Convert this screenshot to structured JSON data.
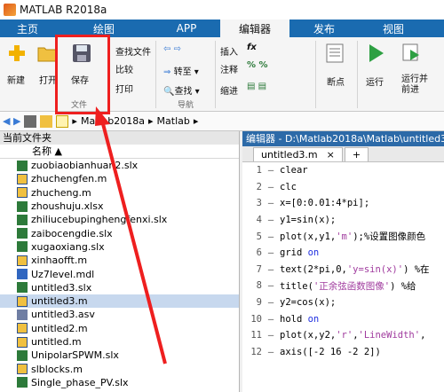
{
  "window": {
    "title": "MATLAB R2018a"
  },
  "tabs": [
    "主页",
    "绘图",
    "APP",
    "编辑器",
    "发布",
    "视图"
  ],
  "ribbon": {
    "new": "新建",
    "open": "打开",
    "save": "保存",
    "find_files": "查找文件",
    "compare": "比较",
    "print": "打印",
    "goto": "转至",
    "find": "查找",
    "nav_label": "导航",
    "insert": "插入",
    "comment": "注释",
    "indent": "缩进",
    "breakpoints": "断点",
    "run": "运行",
    "run_advance_1": "运行并",
    "run_advance_2": "前进",
    "file_label": "文件"
  },
  "address": {
    "path": [
      "Matlab2018a",
      "Matlab"
    ]
  },
  "file_panel": {
    "title": "当前文件夹",
    "column": "名称 ▲"
  },
  "files": [
    {
      "name": "zuobiaobianhuan2.slx",
      "type": "xlsx"
    },
    {
      "name": "zhuchengfen.m",
      "type": "m"
    },
    {
      "name": "zhucheng.m",
      "type": "m"
    },
    {
      "name": "zhoushuju.xlsx",
      "type": "xlsx"
    },
    {
      "name": "zhiliucebupinghengfenxi.slx",
      "type": "xlsx"
    },
    {
      "name": "zaibocengdie.slx",
      "type": "xlsx"
    },
    {
      "name": "xugaoxiang.slx",
      "type": "xlsx"
    },
    {
      "name": "xinhaofft.m",
      "type": "m"
    },
    {
      "name": "Uz7level.mdl",
      "type": "mdl"
    },
    {
      "name": "untitled3.slx",
      "type": "xlsx"
    },
    {
      "name": "untitled3.m",
      "type": "m",
      "selected": true
    },
    {
      "name": "untitled3.asv",
      "type": "asv"
    },
    {
      "name": "untitled2.m",
      "type": "m"
    },
    {
      "name": "untitled.m",
      "type": "m"
    },
    {
      "name": "UnipolarSPWM.slx",
      "type": "xlsx"
    },
    {
      "name": "slblocks.m",
      "type": "m"
    },
    {
      "name": "Single_phase_PV.slx",
      "type": "xlsx"
    }
  ],
  "editor": {
    "title": "编辑器 - D:\\Matlab2018a\\Matlab\\untitled3.m",
    "tab": "untitled3.m",
    "add_tab": "+",
    "lines": [
      {
        "n": "1",
        "code": "clear"
      },
      {
        "n": "2",
        "code": "clc"
      },
      {
        "n": "3",
        "code": "x=[0:0.01:4*pi];"
      },
      {
        "n": "4",
        "code": "y1=sin(x);"
      },
      {
        "n": "5",
        "code": "plot(x,y1,'m');%设置图像颜色"
      },
      {
        "n": "6",
        "code": "grid on"
      },
      {
        "n": "7",
        "code": "text(2*pi,0,'y=sin(x)') %在"
      },
      {
        "n": "8",
        "code": "title('正余弦函数图像') %给"
      },
      {
        "n": "9",
        "code": "y2=cos(x);"
      },
      {
        "n": "10",
        "code": "hold on"
      },
      {
        "n": "11",
        "code": "plot(x,y2,'r','LineWidth',"
      },
      {
        "n": "12",
        "code": "axis([-2 16 -2 2])"
      }
    ]
  }
}
